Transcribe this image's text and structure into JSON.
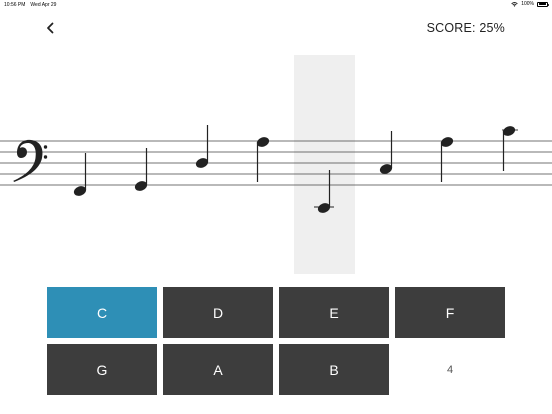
{
  "status_bar": {
    "time": "10:56 PM",
    "date": "Wed Apr 29",
    "battery": "100%"
  },
  "header": {
    "back_icon": "chevron-left-icon",
    "score": "SCORE: 25%"
  },
  "staff": {
    "clef": "bass",
    "highlight_color": "#efefef"
  },
  "answers": {
    "buttons": [
      {
        "label": "C",
        "selected": true
      },
      {
        "label": "D",
        "selected": false
      },
      {
        "label": "E",
        "selected": false
      },
      {
        "label": "F",
        "selected": false
      },
      {
        "label": "G",
        "selected": false
      },
      {
        "label": "A",
        "selected": false
      },
      {
        "label": "B",
        "selected": false
      }
    ],
    "count": "4"
  },
  "colors": {
    "button": "#3d3d3d",
    "selected": "#2e8fb6"
  }
}
